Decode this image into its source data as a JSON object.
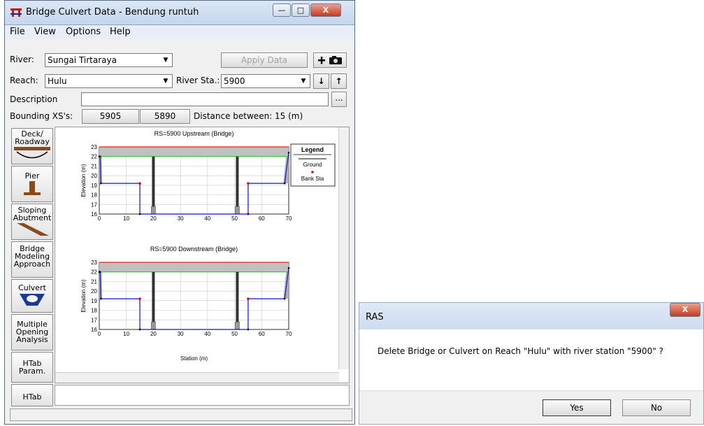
{
  "window": {
    "title": "Bridge Culvert Data - Bendung runtuh",
    "minimize_label": "—",
    "maximize_label": "□",
    "close_label": "X"
  },
  "menu": [
    "File",
    "View",
    "Options",
    "Help"
  ],
  "form": {
    "river_label": "River:",
    "river_value": "Sungai Tirtaraya",
    "apply_label": "Apply Data",
    "reach_label": "Reach:",
    "reach_value": "Hulu",
    "river_sta_label": "River Sta.:",
    "river_sta_value": "5900",
    "description_label": "Description",
    "description_value": "",
    "bounding_label": "Bounding XS's:",
    "bounding_up": "5905",
    "bounding_down": "5890",
    "distance_text": "Distance between: 15 (m)"
  },
  "side_buttons": [
    {
      "label": "Deck/ Roadway"
    },
    {
      "label": "Pier"
    },
    {
      "label": "Sloping Abutment"
    },
    {
      "label": "Bridge Modeling Approach"
    },
    {
      "label": "Culvert"
    },
    {
      "label": "Multiple Opening Analysis"
    },
    {
      "label": "HTab Param."
    },
    {
      "label": "HTab"
    }
  ],
  "plots": {
    "upstream_title": "RS=5900    Upstream  (Bridge)",
    "downstream_title": "RS=5900    Downstream  (Bridge)",
    "ylabel": "Elevation (m)",
    "xlabel": "Station (m)",
    "y_ticks": [
      "23",
      "22",
      "21",
      "20",
      "19",
      "18",
      "17",
      "16"
    ],
    "x_ticks": [
      "0",
      "10",
      "20",
      "30",
      "40",
      "50",
      "60",
      "70"
    ],
    "legend_title": "Legend",
    "legend_ground": "Ground",
    "legend_bank": "Bank Sta",
    "colors": {
      "deck": "#c0c0c0",
      "ground": "#1010d0",
      "bank": "#d01010",
      "top": "#e02020",
      "green": "#20c020"
    }
  },
  "dialog": {
    "title": "RAS",
    "close_label": "X",
    "message": "Delete Bridge or Culvert on Reach \"Hulu\" with river station \"5900\" ?",
    "yes_label": "Yes",
    "no_label": "No"
  }
}
